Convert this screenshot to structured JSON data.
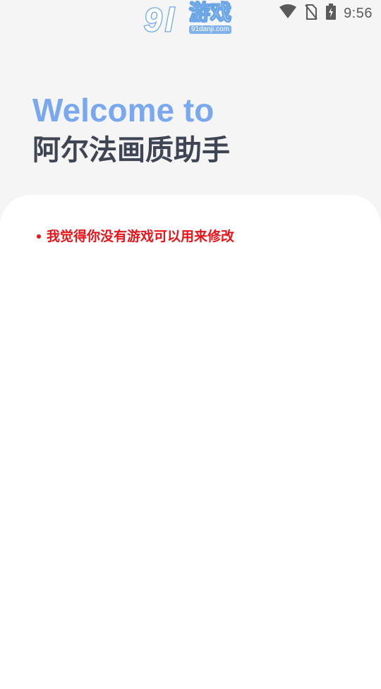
{
  "status_bar": {
    "time": "9:56",
    "icons": [
      "wifi-icon",
      "no-sim-icon",
      "battery-charging-icon"
    ]
  },
  "watermark": {
    "logo_text": "9l",
    "brand": "游戏",
    "site": "91danji.com"
  },
  "header": {
    "welcome": "Welcome to",
    "app_name": "阿尔法画质助手"
  },
  "notice": {
    "text": "我觉得你没有游戏可以用来修改",
    "color": "#e8141a"
  },
  "colors": {
    "accent": "#79a8ef",
    "title": "#3f4553",
    "background": "#f5f5f5",
    "card": "#ffffff"
  }
}
